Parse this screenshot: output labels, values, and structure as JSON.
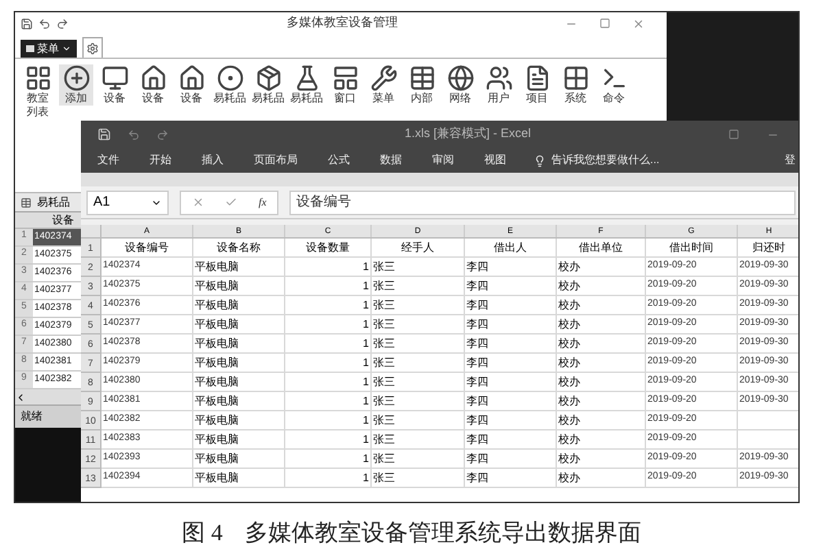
{
  "app_window": {
    "title": "多媒体教室设备管理",
    "menu_button": "菜单",
    "ribbon": [
      {
        "line1": "教室",
        "line2": "列表"
      },
      {
        "line1": "添加"
      },
      {
        "line1": "设备"
      },
      {
        "line1": "设备"
      },
      {
        "line1": "设备"
      },
      {
        "line1": "易耗品"
      },
      {
        "line1": "易耗品"
      },
      {
        "line1": "易耗品"
      },
      {
        "line1": "窗口"
      },
      {
        "line1": "菜单"
      },
      {
        "line1": "内部"
      },
      {
        "line1": "网络"
      },
      {
        "line1": "用户"
      },
      {
        "line1": "项目"
      },
      {
        "line1": "系统"
      },
      {
        "line1": "命令"
      }
    ],
    "tab": "易耗品",
    "grid_header": "设备",
    "rows": [
      {
        "num": "1",
        "id": "1402374",
        "selected": true
      },
      {
        "num": "2",
        "id": "1402375",
        "selected": false
      },
      {
        "num": "3",
        "id": "1402376",
        "selected": false
      },
      {
        "num": "4",
        "id": "1402377",
        "selected": false
      },
      {
        "num": "5",
        "id": "1402378",
        "selected": false
      },
      {
        "num": "6",
        "id": "1402379",
        "selected": false
      },
      {
        "num": "7",
        "id": "1402380",
        "selected": false
      },
      {
        "num": "8",
        "id": "1402381",
        "selected": false
      },
      {
        "num": "9",
        "id": "1402382",
        "selected": false
      }
    ],
    "status": "就绪"
  },
  "excel": {
    "title": "1.xls  [兼容模式] - Excel",
    "tabs": [
      "文件",
      "开始",
      "插入",
      "页面布局",
      "公式",
      "数据",
      "审阅",
      "视图"
    ],
    "tell_me": "告诉我您想要做什么...",
    "sign_in": "登",
    "name_box": "A1",
    "function_button": "fx",
    "formula": "设备编号",
    "columns": [
      "A",
      "B",
      "C",
      "D",
      "E",
      "F",
      "G",
      "H"
    ],
    "rows": [
      {
        "num": "1",
        "cells": [
          "设备编号",
          "设备名称",
          "设备数量",
          "经手人",
          "借出人",
          "借出单位",
          "借出时间",
          "归还时"
        ]
      },
      {
        "num": "2",
        "cells": [
          "1402374",
          "平板电脑",
          "1",
          "张三",
          "李四",
          "校办",
          "2019-09-20",
          "2019-09-30"
        ]
      },
      {
        "num": "3",
        "cells": [
          "1402375",
          "平板电脑",
          "1",
          "张三",
          "李四",
          "校办",
          "2019-09-20",
          "2019-09-30"
        ]
      },
      {
        "num": "4",
        "cells": [
          "1402376",
          "平板电脑",
          "1",
          "张三",
          "李四",
          "校办",
          "2019-09-20",
          "2019-09-30"
        ]
      },
      {
        "num": "5",
        "cells": [
          "1402377",
          "平板电脑",
          "1",
          "张三",
          "李四",
          "校办",
          "2019-09-20",
          "2019-09-30"
        ]
      },
      {
        "num": "6",
        "cells": [
          "1402378",
          "平板电脑",
          "1",
          "张三",
          "李四",
          "校办",
          "2019-09-20",
          "2019-09-30"
        ]
      },
      {
        "num": "7",
        "cells": [
          "1402379",
          "平板电脑",
          "1",
          "张三",
          "李四",
          "校办",
          "2019-09-20",
          "2019-09-30"
        ]
      },
      {
        "num": "8",
        "cells": [
          "1402380",
          "平板电脑",
          "1",
          "张三",
          "李四",
          "校办",
          "2019-09-20",
          "2019-09-30"
        ]
      },
      {
        "num": "9",
        "cells": [
          "1402381",
          "平板电脑",
          "1",
          "张三",
          "李四",
          "校办",
          "2019-09-20",
          "2019-09-30"
        ]
      },
      {
        "num": "10",
        "cells": [
          "1402382",
          "平板电脑",
          "1",
          "张三",
          "李四",
          "校办",
          "2019-09-20",
          ""
        ]
      },
      {
        "num": "11",
        "cells": [
          "1402383",
          "平板电脑",
          "1",
          "张三",
          "李四",
          "校办",
          "2019-09-20",
          ""
        ]
      },
      {
        "num": "12",
        "cells": [
          "1402393",
          "平板电脑",
          "1",
          "张三",
          "李四",
          "校办",
          "2019-09-20",
          "2019-09-30"
        ]
      },
      {
        "num": "13",
        "cells": [
          "1402394",
          "平板电脑",
          "1",
          "张三",
          "李四",
          "校办",
          "2019-09-20",
          "2019-09-30"
        ]
      }
    ]
  },
  "caption": {
    "label": "图 4",
    "text": "多媒体教室设备管理系统导出数据界面"
  }
}
